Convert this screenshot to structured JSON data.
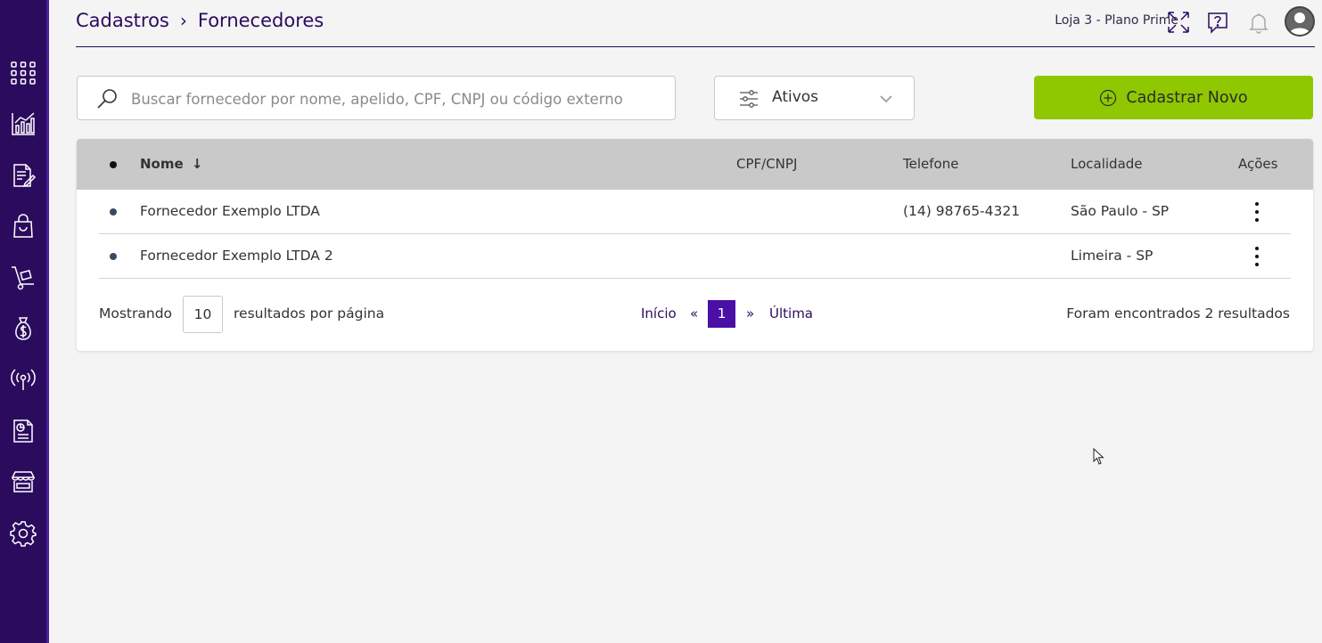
{
  "sidebar": {
    "items": [
      {
        "icon": "apps-grid-icon"
      },
      {
        "icon": "analytics-chart-icon"
      },
      {
        "icon": "document-edit-icon"
      },
      {
        "icon": "shopping-bag-icon"
      },
      {
        "icon": "hand-truck-icon"
      },
      {
        "icon": "money-bag-icon"
      },
      {
        "icon": "broadcast-icon"
      },
      {
        "icon": "report-document-icon"
      },
      {
        "icon": "storefront-icon"
      },
      {
        "icon": "settings-gear-icon"
      }
    ],
    "colors": {
      "background": "#2b0b5e"
    }
  },
  "header": {
    "breadcrumb": [
      "Cadastros",
      "Fornecedores"
    ],
    "store_label": "Loja 3 - Plano Prime"
  },
  "toolbar": {
    "search_placeholder": "Buscar fornecedor por nome, apelido, CPF, CNPJ ou código externo",
    "search_value": "",
    "filter_value": "Ativos",
    "new_button_label": "Cadastrar Novo",
    "new_button_color": "#8fc800"
  },
  "table": {
    "columns": {
      "nome": "Nome",
      "doc": "CPF/CNPJ",
      "telefone": "Telefone",
      "localidade": "Localidade",
      "acoes": "Ações"
    },
    "rows": [
      {
        "nome": "Fornecedor Exemplo LTDA",
        "doc": "",
        "telefone": "(14) 98765-4321",
        "localidade": "São Paulo - SP"
      },
      {
        "nome": "Fornecedor Exemplo LTDA 2",
        "doc": "",
        "telefone": "",
        "localidade": "Limeira - SP"
      }
    ]
  },
  "pagination": {
    "showing_label": "Mostrando",
    "per_page": "10",
    "per_page_suffix": "resultados por página",
    "first_label": "Início",
    "prev_label": "«",
    "current_page": "1",
    "next_label": "»",
    "last_label": "Última",
    "result_count": "Foram encontrados 2 resultados",
    "accent_color": "#4a0fa5"
  }
}
